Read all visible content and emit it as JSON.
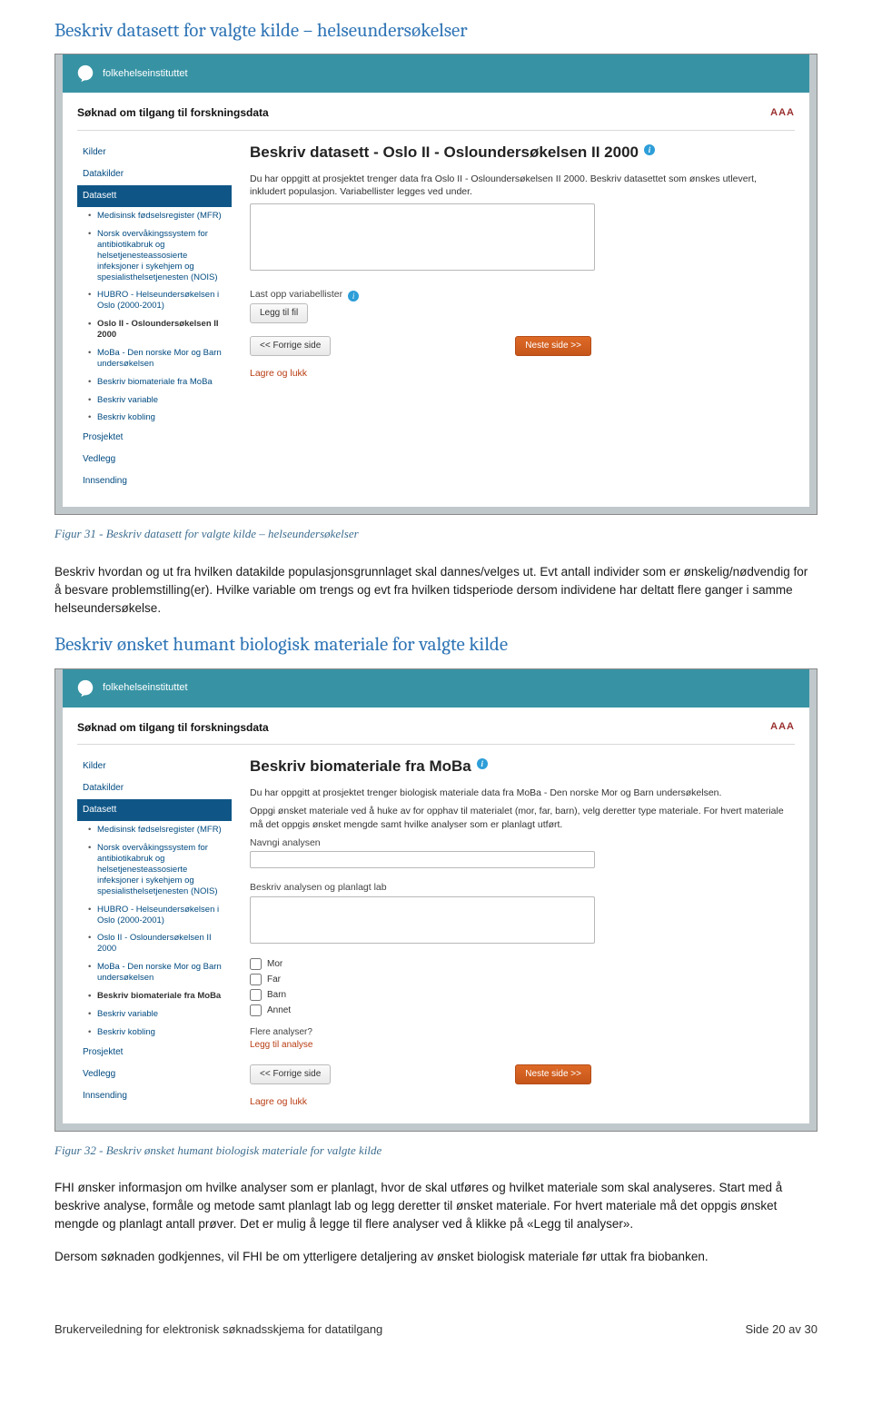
{
  "title1": "Beskriv datasett for valgte kilde – helseundersøkelser",
  "caption1": "Figur 31 - Beskriv datasett for valgte kilde – helseundersøkelser",
  "para1": "Beskriv hvordan og ut fra hvilken datakilde populasjonsgrunnlaget skal dannes/velges ut. Evt antall individer som er ønskelig/nødvendig for å besvare problemstilling(er). Hvilke variable om trengs og evt fra hvilken tidsperiode dersom individene har deltatt flere ganger i samme helseundersøkelse.",
  "title2": "Beskriv ønsket humant biologisk materiale for valgte kilde",
  "caption2": "Figur 32 - Beskriv ønsket humant biologisk materiale for valgte kilde",
  "para2": "FHI ønsker informasjon om hvilke analyser som er planlagt, hvor de skal utføres og hvilket materiale som skal analyseres. Start med å beskrive analyse, formåle og metode samt planlagt lab og legg deretter til ønsket materiale. For hvert materiale må det oppgis ønsket mengde og planlagt antall prøver. Det er mulig å legge til flere analyser ved å klikke på «Legg til analyser».",
  "para3": "Dersom søknaden godkjennes, vil FHI be om ytterligere detaljering av ønsket biologisk materiale før uttak fra biobanken.",
  "footer_left": "Brukerveiledning for elektronisk søknadsskjema for datatilgang",
  "footer_right": "Side 20 av 30",
  "ss_common": {
    "brand": "folkehelseinstituttet",
    "page_header": "Søknad om tilgang til forskningsdata",
    "aaa": "AAA",
    "nav": {
      "kilder": "Kilder",
      "datakilder": "Datakilder",
      "datasett": "Datasett",
      "prosjektet": "Prosjektet",
      "vedlegg": "Vedlegg",
      "innsending": "Innsending"
    },
    "sub": {
      "mfr": "Medisinsk fødselsregister (MFR)",
      "nois": "Norsk overvåkingssystem for antibiotikabruk og helsetjenesteassosierte infeksjoner i sykehjem og spesialisthelsetjenesten (NOIS)",
      "hubro": "HUBRO - Helseundersøkelsen i Oslo (2000-2001)",
      "oslo2": "Oslo II - Osloundersøkelsen II 2000",
      "moba": "MoBa - Den norske Mor og Barn undersøkelsen",
      "biomat": "Beskriv biomateriale fra MoBa",
      "variable": "Beskriv variable",
      "kobling": "Beskriv kobling"
    },
    "btn_prev": "<< Forrige side",
    "btn_next": "Neste side >>",
    "btn_leggtilfil": "Legg til fil",
    "lagre_lukk": "Lagre og lukk"
  },
  "ss1": {
    "heading": "Beskriv datasett - Oslo II - Osloundersøkelsen II 2000",
    "p1": "Du har oppgitt at prosjektet trenger data fra Oslo II - Osloundersøkelsen II 2000. Beskriv datasettet som ønskes utlevert, inkludert populasjon. Variabellister legges ved under.",
    "upload_label": "Last opp variabellister"
  },
  "ss2": {
    "heading": "Beskriv biomateriale fra MoBa",
    "p1": "Du har oppgitt at prosjektet trenger biologisk materiale data fra MoBa - Den norske Mor og Barn undersøkelsen.",
    "p2": "Oppgi ønsket materiale ved å huke av for opphav til materialet (mor, far, barn), velg deretter type materiale. For hvert materiale må det oppgis ønsket mengde samt hvilke analyser som er planlagt utført.",
    "lbl1": "Navngi analysen",
    "lbl2": "Beskriv analysen og planlagt lab",
    "chk_mor": "Mor",
    "chk_far": "Far",
    "chk_barn": "Barn",
    "chk_annet": "Annet",
    "flere": "Flere analyser?",
    "flere_link": "Legg til analyse"
  }
}
